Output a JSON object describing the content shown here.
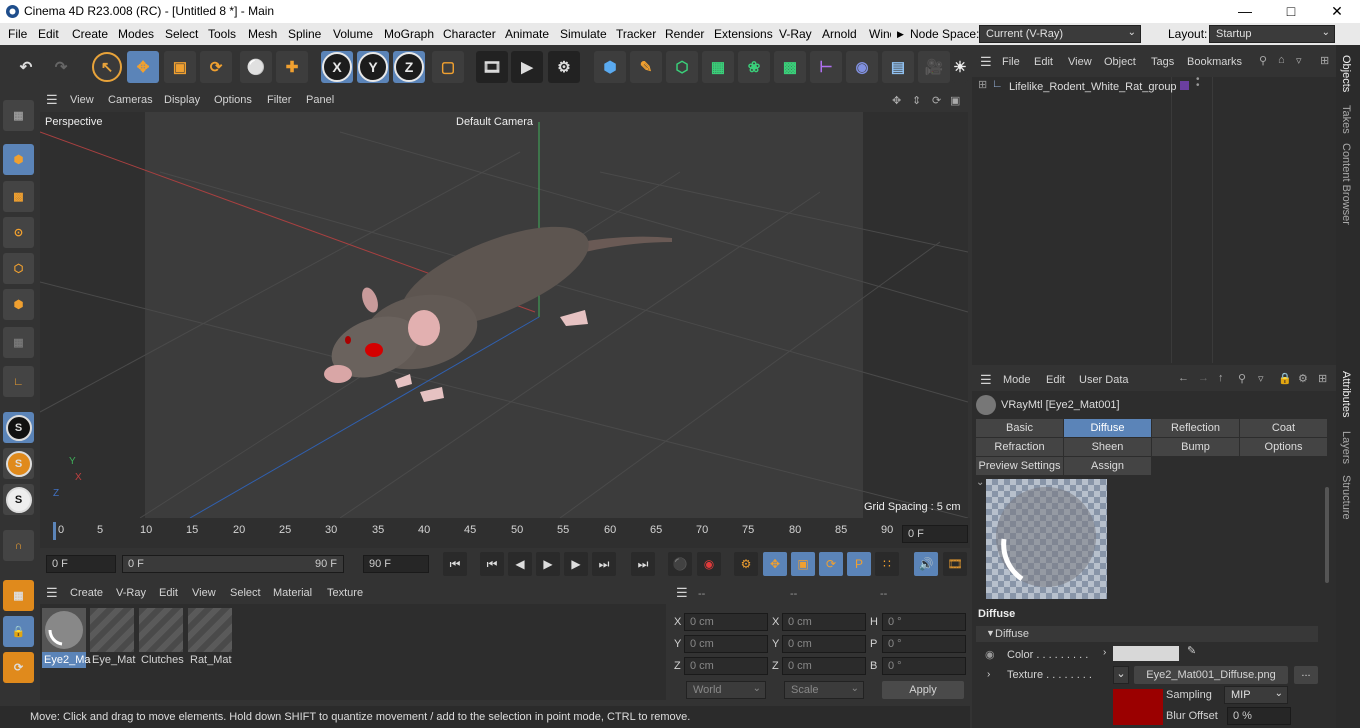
{
  "window": {
    "title": "Cinema 4D R23.008 (RC) - [Untitled 8 *] - Main"
  },
  "menu": {
    "items": [
      "File",
      "Edit",
      "Create",
      "Modes",
      "Select",
      "Tools",
      "Mesh",
      "Spline",
      "Volume",
      "MoGraph",
      "Character",
      "Animate",
      "Simulate",
      "Tracker",
      "Render",
      "Extensions",
      "V-Ray",
      "Arnold",
      "Wind"
    ],
    "node_space_label": "Node Space:",
    "node_space_value": "Current (V-Ray)",
    "layout_label": "Layout:",
    "layout_value": "Startup"
  },
  "toolbar": {
    "axis_x": "X",
    "axis_y": "Y",
    "axis_z": "Z"
  },
  "viewport": {
    "menu": [
      "View",
      "Cameras",
      "Display",
      "Options",
      "Filter",
      "Panel"
    ],
    "view_name": "Perspective",
    "camera_name": "Default Camera",
    "grid_spacing": "Grid Spacing : 5 cm",
    "axis_labels": {
      "x": "X",
      "y": "Y",
      "z": "Z"
    }
  },
  "timeline": {
    "ticks": [
      "0",
      "5",
      "10",
      "15",
      "20",
      "25",
      "30",
      "35",
      "40",
      "45",
      "50",
      "55",
      "60",
      "65",
      "70",
      "75",
      "80",
      "85",
      "90"
    ],
    "current_frame": "0 F",
    "start_field": "0 F",
    "range_start": "0 F",
    "range_end": "90 F",
    "end_field": "90 F"
  },
  "materials": {
    "menu": [
      "Create",
      "V-Ray",
      "Edit",
      "View",
      "Select",
      "Material",
      "Texture"
    ],
    "items": [
      {
        "name": "Eye2_Ma",
        "selected": true
      },
      {
        "name": "Eye_Mat",
        "selected": false
      },
      {
        "name": "Clutches",
        "selected": false
      },
      {
        "name": "Rat_Mat",
        "selected": false
      }
    ]
  },
  "coords": {
    "headers": [
      "--",
      "--",
      "--"
    ],
    "rows": [
      {
        "a": "X",
        "av": "0 cm",
        "b": "X",
        "bv": "0 cm",
        "c": "H",
        "cv": "0 °"
      },
      {
        "a": "Y",
        "av": "0 cm",
        "b": "Y",
        "bv": "0 cm",
        "c": "P",
        "cv": "0 °"
      },
      {
        "a": "Z",
        "av": "0 cm",
        "b": "Z",
        "bv": "0 cm",
        "c": "B",
        "cv": "0 °"
      }
    ],
    "world": "World",
    "scale": "Scale",
    "apply": "Apply"
  },
  "status": "Move: Click and drag to move elements. Hold down SHIFT to quantize movement / add to the selection in point mode, CTRL to remove.",
  "objects": {
    "menu": [
      "File",
      "Edit",
      "View",
      "Object",
      "Tags",
      "Bookmarks"
    ],
    "items": [
      {
        "name": "Lifelike_Rodent_White_Rat_group"
      }
    ]
  },
  "attributes": {
    "menu": [
      "Mode",
      "Edit",
      "User Data"
    ],
    "material_name": "VRayMtl [Eye2_Mat001]",
    "tabs_row1": [
      "Basic",
      "Diffuse",
      "Reflection",
      "Coat"
    ],
    "tabs_row2": [
      "Refraction",
      "Sheen",
      "Bump",
      "Options"
    ],
    "tabs_row3": [
      "Preview Settings",
      "Assign"
    ],
    "active_tab": "Diffuse",
    "section_title": "Diffuse",
    "group_title": "Diffuse",
    "color_label": "Color . . . . . . . . .",
    "texture_label": "Texture . . . . . . . .",
    "texture_file": "Eye2_Mat001_Diffuse.png",
    "more_button": "...",
    "sampling_label": "Sampling",
    "sampling_value": "MIP",
    "blur_label": "Blur Offset",
    "blur_value": "0 %",
    "colors": {
      "diffuse_swatch": "#d8d8d8",
      "texture_swatch": "#9b0000"
    }
  },
  "side_tabs": [
    "Objects",
    "Takes",
    "Content Browser",
    "Attributes",
    "Layers",
    "Structure"
  ]
}
